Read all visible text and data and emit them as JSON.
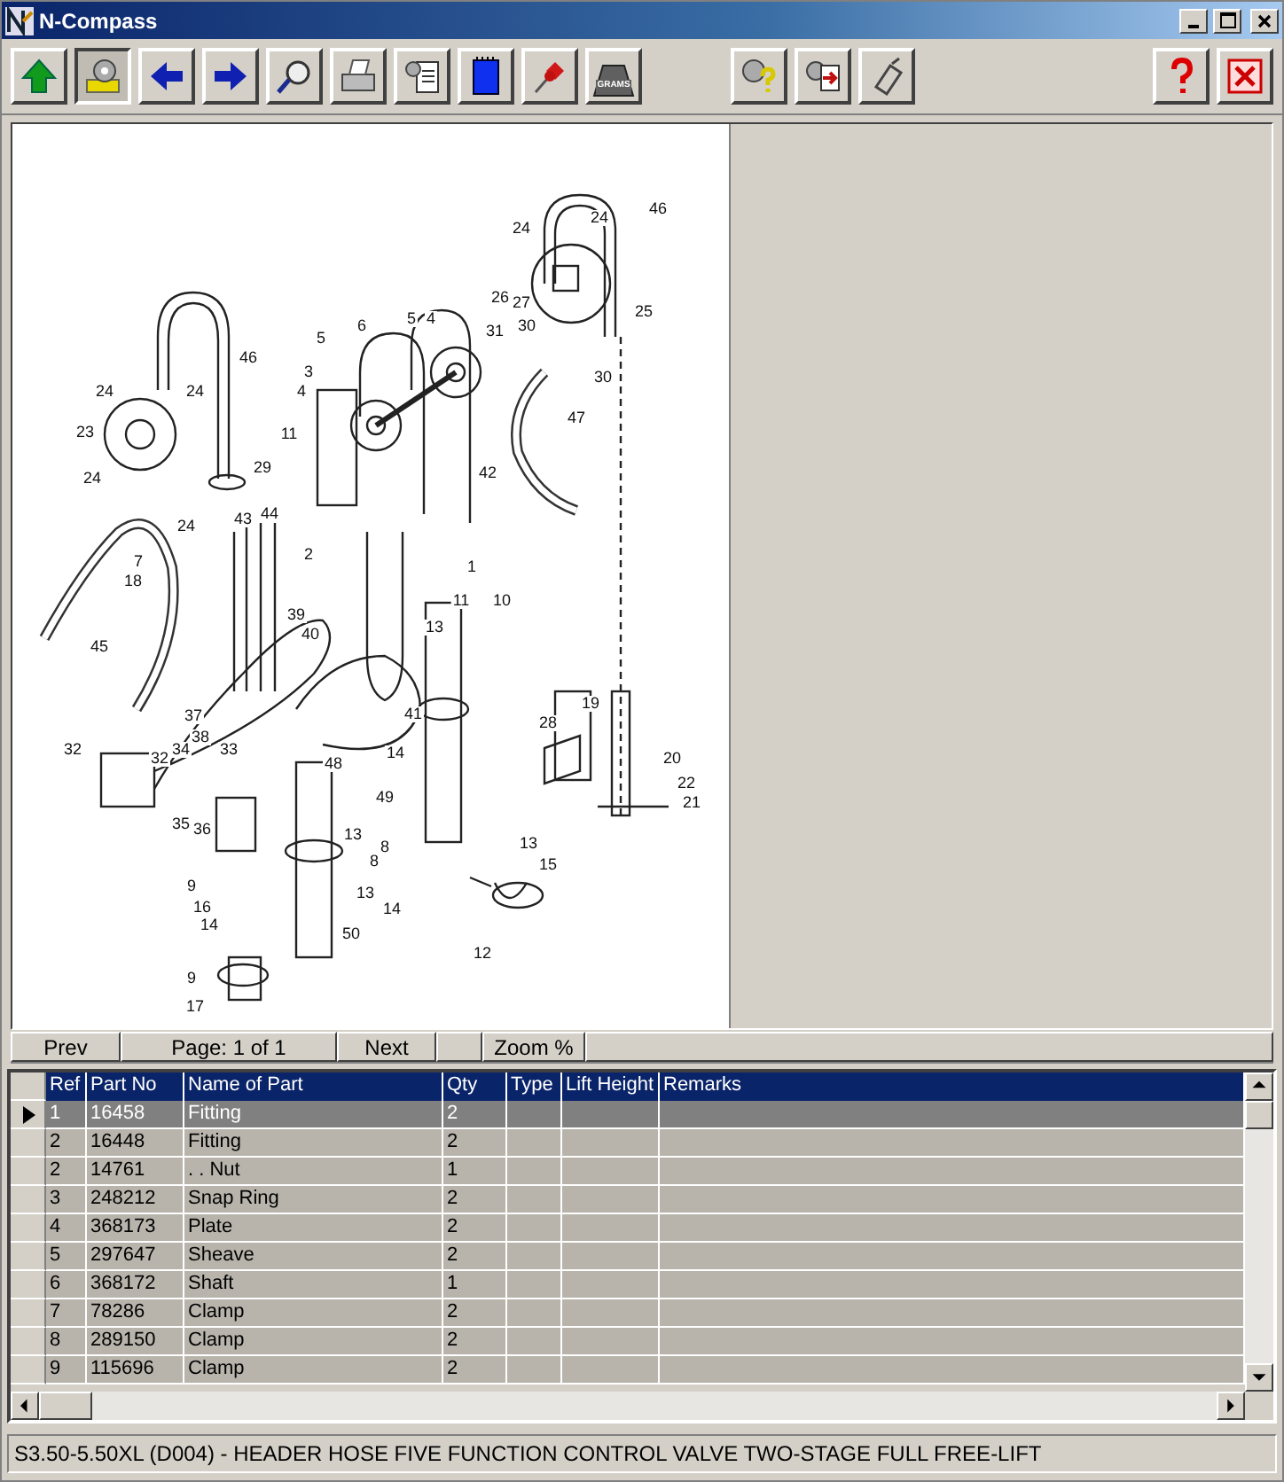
{
  "window": {
    "title": "N-Compass"
  },
  "toolbar": {
    "groups": [
      [
        {
          "pressed": false
        },
        {
          "pressed": true
        },
        {
          "pressed": false
        },
        {
          "pressed": false
        },
        {
          "pressed": false
        },
        {
          "pressed": false
        },
        {
          "pressed": false
        },
        {
          "pressed": false
        },
        {
          "pressed": false
        },
        {
          "pressed": false,
          "label": "GRAMS"
        }
      ],
      [
        {
          "pressed": false
        },
        {
          "pressed": false
        },
        {
          "pressed": false
        }
      ],
      [
        {
          "pressed": false
        },
        {
          "pressed": false
        }
      ]
    ]
  },
  "diagram": {
    "callouts": [
      "46",
      "24",
      "24",
      "26",
      "27",
      "25",
      "31",
      "30",
      "30",
      "47",
      "46",
      "24",
      "24",
      "23",
      "29",
      "24",
      "24",
      "43",
      "44",
      "7",
      "18",
      "45",
      "5",
      "6",
      "5",
      "4",
      "3",
      "4",
      "11",
      "42",
      "2",
      "1",
      "11",
      "10",
      "13",
      "39",
      "40",
      "37",
      "38",
      "41",
      "48",
      "32",
      "32",
      "34",
      "33",
      "35",
      "36",
      "13",
      "8",
      "9",
      "16",
      "14",
      "13",
      "50",
      "9",
      "17",
      "14",
      "49",
      "19",
      "28",
      "20",
      "22",
      "21",
      "8",
      "13",
      "15",
      "14",
      "12"
    ]
  },
  "pager": {
    "prev": "Prev",
    "page": "Page: 1 of 1",
    "next": "Next",
    "zoom": "Zoom %"
  },
  "table": {
    "columns": [
      "Ref",
      "Part No",
      "Name of Part",
      "Qty",
      "Type",
      "Lift Height",
      "Remarks"
    ],
    "rows": [
      {
        "cells": [
          "1",
          "16458",
          "Fitting",
          "2",
          "",
          "",
          ""
        ],
        "selected": true
      },
      {
        "cells": [
          "2",
          "16448",
          "Fitting",
          "2",
          "",
          "",
          ""
        ],
        "selected": false
      },
      {
        "cells": [
          "2",
          "14761",
          ". . Nut",
          "1",
          "",
          "",
          ""
        ],
        "selected": false
      },
      {
        "cells": [
          "3",
          "248212",
          "Snap Ring",
          "2",
          "",
          "",
          ""
        ],
        "selected": false
      },
      {
        "cells": [
          "4",
          "368173",
          "Plate",
          "2",
          "",
          "",
          ""
        ],
        "selected": false
      },
      {
        "cells": [
          "5",
          "297647",
          "Sheave",
          "2",
          "",
          "",
          ""
        ],
        "selected": false
      },
      {
        "cells": [
          "6",
          "368172",
          "Shaft",
          "1",
          "",
          "",
          ""
        ],
        "selected": false
      },
      {
        "cells": [
          "7",
          "78286",
          "Clamp",
          "2",
          "",
          "",
          ""
        ],
        "selected": false
      },
      {
        "cells": [
          "8",
          "289150",
          "Clamp",
          "2",
          "",
          "",
          ""
        ],
        "selected": false
      },
      {
        "cells": [
          "9",
          "115696",
          "Clamp",
          "2",
          "",
          "",
          ""
        ],
        "selected": false
      }
    ]
  },
  "status_bar": {
    "text": "S3.50-5.50XL (D004) - HEADER HOSE FIVE FUNCTION CONTROL VALVE TWO-STAGE FULL FREE-LIFT"
  }
}
